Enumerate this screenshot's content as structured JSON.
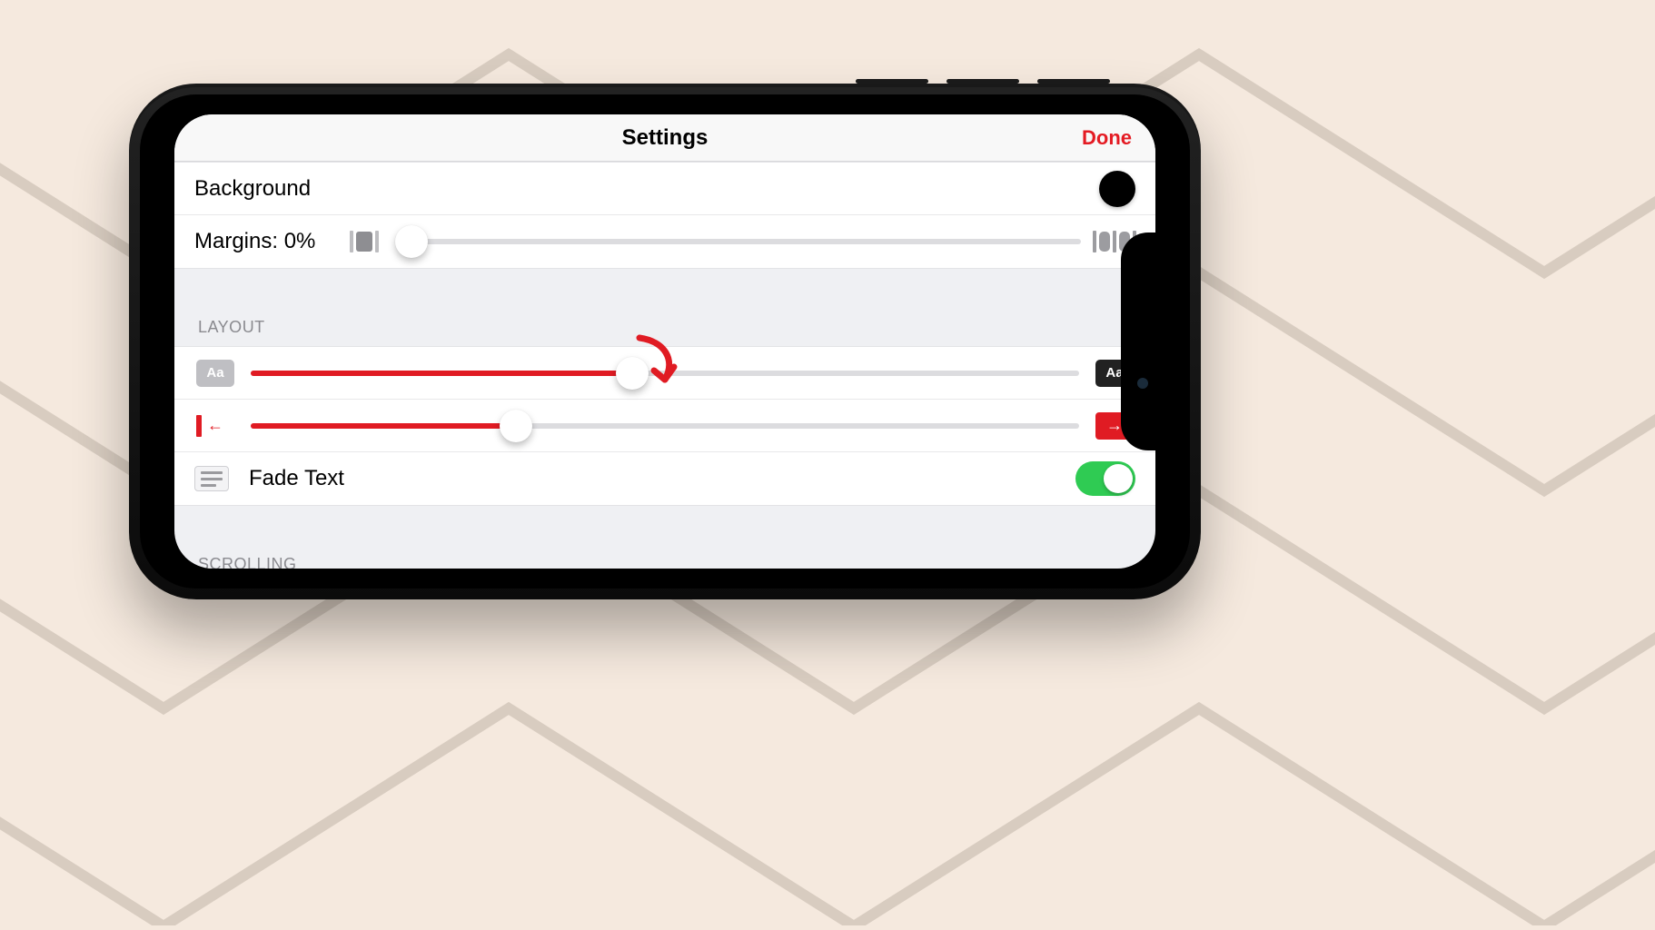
{
  "header": {
    "title": "Settings",
    "done_label": "Done"
  },
  "appearance": {
    "background_label": "Background",
    "background_color": "#000000",
    "margins_label": "Margins: 0%",
    "margins_value_pct": 0
  },
  "sections": {
    "layout_header": "LAYOUT",
    "scrolling_header": "SCROLLING"
  },
  "layout": {
    "text_size_slider_pct": 46,
    "scroll_speed_slider_pct": 32,
    "fade_text_label": "Fade Text",
    "fade_text_on": true
  },
  "icons": {
    "aa_small": "Aa",
    "aa_large": "Aa"
  },
  "colors": {
    "accent": "#e01b23",
    "toggle_on": "#2fcb53"
  }
}
